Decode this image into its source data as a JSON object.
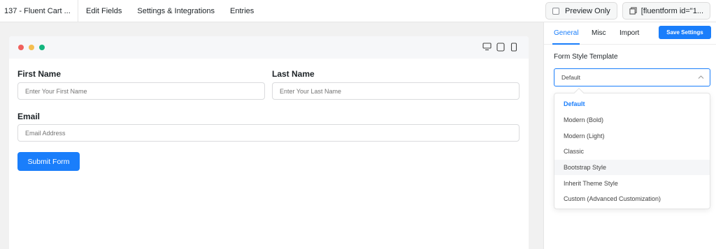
{
  "topbar": {
    "title": "137 - Fluent Cart ...",
    "nav": [
      "Edit Fields",
      "Settings & Integrations",
      "Entries"
    ],
    "preview_only": "Preview Only",
    "shortcode": "[fluentform id=\"1..."
  },
  "form": {
    "first_name_label": "First Name",
    "first_name_placeholder": "Enter Your First Name",
    "last_name_label": "Last Name",
    "last_name_placeholder": "Enter Your Last Name",
    "email_label": "Email",
    "email_placeholder": "Email Address",
    "submit_label": "Submit Form"
  },
  "panel": {
    "tabs": [
      "General",
      "Misc",
      "Import"
    ],
    "save_label": "Save Settings",
    "section_label": "Form Style Template",
    "selected_value": "Default",
    "options": [
      "Default",
      "Modern (Bold)",
      "Modern (Light)",
      "Classic",
      "Bootstrap Style",
      "Inherit Theme Style",
      "Custom (Advanced Customization)"
    ]
  },
  "icons": [
    "checkbox-icon",
    "copy-icon",
    "desktop-icon",
    "tablet-icon",
    "mobile-icon",
    "chevron-up-icon"
  ],
  "colors": {
    "accent": "#1a7efb",
    "dot_red": "#f0605d",
    "dot_yellow": "#f5be4f",
    "dot_green": "#13b57e"
  }
}
